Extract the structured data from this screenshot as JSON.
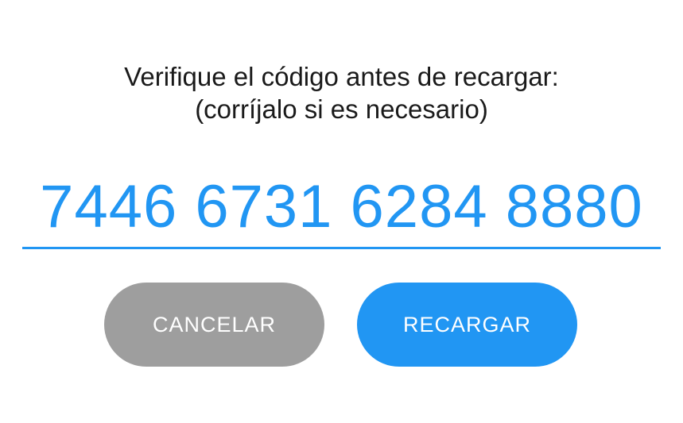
{
  "dialog": {
    "instruction_line1": "Verifique el código antes de recargar:",
    "instruction_line2": "(corríjalo si es necesario)",
    "code_value": "7446 6731 6284 8880",
    "cancel_label": "CANCELAR",
    "reload_label": "RECARGAR"
  },
  "colors": {
    "accent": "#2196f3",
    "cancel_button": "#9e9e9e",
    "button_text": "#ffffff",
    "text": "#1a1a1a"
  }
}
